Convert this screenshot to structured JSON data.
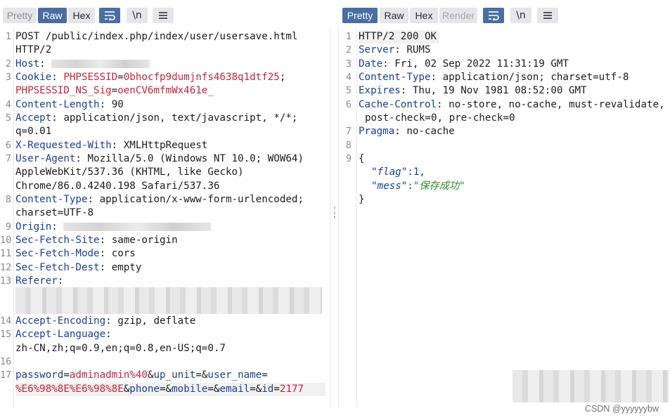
{
  "request": {
    "tabs": [
      {
        "label": "Pretty",
        "state": "dim"
      },
      {
        "label": "Raw",
        "state": "active"
      },
      {
        "label": "Hex",
        "state": "normal"
      }
    ],
    "icons": {
      "wrap": "text-wrap-icon",
      "newline": "\\n",
      "menu": "hamburger-menu-icon"
    },
    "lines": {
      "l1a": "POST /public/index.php/index/user/usersave.html",
      "l1b": "HTTP/2",
      "host_key": "Host",
      "cookie_key": "Cookie",
      "cookie_n1": "PHPSESSID",
      "cookie_v1": "0bhocfp9dumjnfs4638q1dtf25",
      "cookie_n2": "PHPSESSID_NS_Sig",
      "cookie_v2": "oenCV6mfmWx461e_",
      "cl_key": "Content-Length",
      "cl_val": "90",
      "accept_key": "Accept",
      "accept_val": "application/json, text/javascript, */*;",
      "accept_val2": "q=0.01",
      "xrw_key": "X-Requested-With",
      "xrw_val": "XMLHttpRequest",
      "ua_key": "User-Agent",
      "ua_val": "Mozilla/5.0 (Windows NT 10.0; WOW64)",
      "ua_val2": "AppleWebKit/537.36 (KHTML, like Gecko)",
      "ua_val3": "Chrome/86.0.4240.198 Safari/537.36",
      "ct_key": "Content-Type",
      "ct_val": "application/x-www-form-urlencoded;",
      "ct_val2": "charset=UTF-8",
      "origin_key": "Origin",
      "sfs_key": "Sec-Fetch-Site",
      "sfs_val": "same-origin",
      "sfm_key": "Sec-Fetch-Mode",
      "sfm_val": "cors",
      "sfd_key": "Sec-Fetch-Dest",
      "sfd_val": "empty",
      "ref_key": "Referer",
      "ae_key": "Accept-Encoding",
      "ae_val": "gzip, deflate",
      "al_key": "Accept-Language",
      "al_val": "zh-CN,zh;q=0.9,en;q=0.8,en-US;q=0.7",
      "b_n1": "password",
      "b_v1": "adminadmin%40",
      "b_n2": "up_unit",
      "b_n3": "user_name",
      "b_v3": "%E6%98%8E%E6%98%8E",
      "b_n4": "phone",
      "b_n5": "mobile",
      "b_n6": "email",
      "b_n7": "id",
      "b_v7": "2177"
    },
    "line_numbers": [
      "1",
      "2",
      "3",
      "4",
      "5",
      "6",
      "7",
      "8",
      "9",
      "10",
      "11",
      "12",
      "13",
      "14",
      "15",
      "16",
      "17"
    ]
  },
  "response": {
    "tabs": [
      {
        "label": "Pretty",
        "state": "active"
      },
      {
        "label": "Raw",
        "state": "normal"
      },
      {
        "label": "Hex",
        "state": "normal"
      },
      {
        "label": "Render",
        "state": "disabled"
      }
    ],
    "icons": {
      "wrap": "text-wrap-icon",
      "newline": "\\n",
      "menu": "hamburger-menu-icon"
    },
    "lines": {
      "status": "HTTP/2 200 OK",
      "server_key": "Server",
      "server_val": "RUMS",
      "date_key": "Date",
      "date_val": "Fri, 02 Sep 2022 11:31:19 GMT",
      "ct_key": "Content-Type",
      "ct_val": "application/json; charset=utf-8",
      "exp_key": "Expires",
      "exp_val": "Thu, 19 Nov 1981 08:52:00 GMT",
      "cc_key": "Cache-Control",
      "cc_val": "no-store, no-cache, must-revalidate,",
      "cc_val2": "post-check=0, pre-check=0",
      "pragma_key": "Pragma",
      "pragma_val": "no-cache",
      "brace_open": "{",
      "flag_key": "\"flag\"",
      "flag_val": "1",
      "mess_key": "\"mess\"",
      "mess_val": "\"保存成功\"",
      "brace_close": "}"
    },
    "line_numbers": [
      "1",
      "2",
      "3",
      "4",
      "5",
      "6",
      "7",
      "8",
      "9"
    ]
  },
  "watermark": "CSDN @yyyyyybw",
  "colors": {
    "accent": "#4a6ea3",
    "header_key": "#1a3e9e",
    "value_red": "#c8243c",
    "json_string": "#2d8a2d"
  }
}
